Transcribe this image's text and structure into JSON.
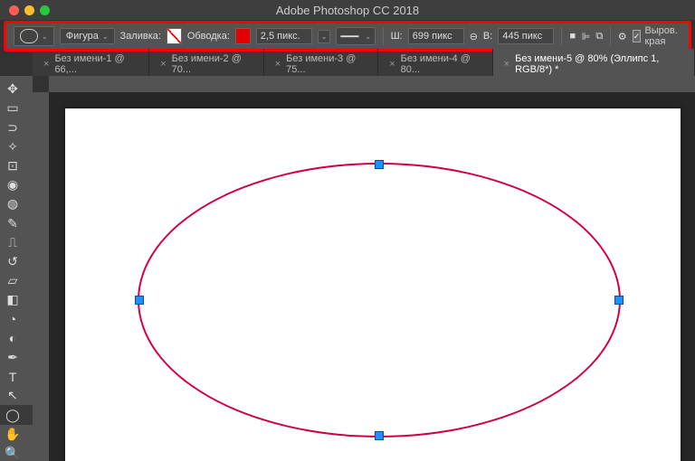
{
  "app_title": "Adobe Photoshop CC 2018",
  "traffic_colors": [
    "#ff5f57",
    "#febc2e",
    "#28c840"
  ],
  "options": {
    "mode": "Фигура",
    "fill_label": "Заливка:",
    "stroke_label": "Обводка:",
    "stroke_width": "2,5 пикс.",
    "w_label": "Ш:",
    "w_value": "699 пикс",
    "h_label": "В:",
    "h_value": "445 пикс",
    "align_edges_label": "Выров. края"
  },
  "tabs": [
    {
      "label": "Без имени-1 @ 66,...",
      "active": false
    },
    {
      "label": "Без имени-2 @ 70...",
      "active": false
    },
    {
      "label": "Без имени-3 @ 75...",
      "active": false
    },
    {
      "label": "Без имени-4 @ 80...",
      "active": false
    },
    {
      "label": "Без имени-5 @ 80% (Эллипс 1, RGB/8*) *",
      "active": true
    }
  ],
  "tools": [
    {
      "n": "move-tool",
      "g": "✥"
    },
    {
      "n": "marquee-tool",
      "g": "▭"
    },
    {
      "n": "lasso-tool",
      "g": "⊃"
    },
    {
      "n": "magic-wand-tool",
      "g": "✧"
    },
    {
      "n": "crop-tool",
      "g": "⊡"
    },
    {
      "n": "eyedropper-tool",
      "g": "◉"
    },
    {
      "n": "healing-brush-tool",
      "g": "◍"
    },
    {
      "n": "brush-tool",
      "g": "✎"
    },
    {
      "n": "stamp-tool",
      "g": "⎍"
    },
    {
      "n": "history-brush-tool",
      "g": "↺"
    },
    {
      "n": "eraser-tool",
      "g": "▱"
    },
    {
      "n": "gradient-tool",
      "g": "◧"
    },
    {
      "n": "blur-tool",
      "g": "◔"
    },
    {
      "n": "dodge-tool",
      "g": "◐"
    },
    {
      "n": "pen-tool",
      "g": "✒"
    },
    {
      "n": "type-tool",
      "g": "T"
    },
    {
      "n": "path-select-tool",
      "g": "↖"
    },
    {
      "n": "shape-tool",
      "g": "◯",
      "sel": true
    },
    {
      "n": "hand-tool",
      "g": "✋"
    },
    {
      "n": "zoom-tool",
      "g": "🔍"
    }
  ]
}
